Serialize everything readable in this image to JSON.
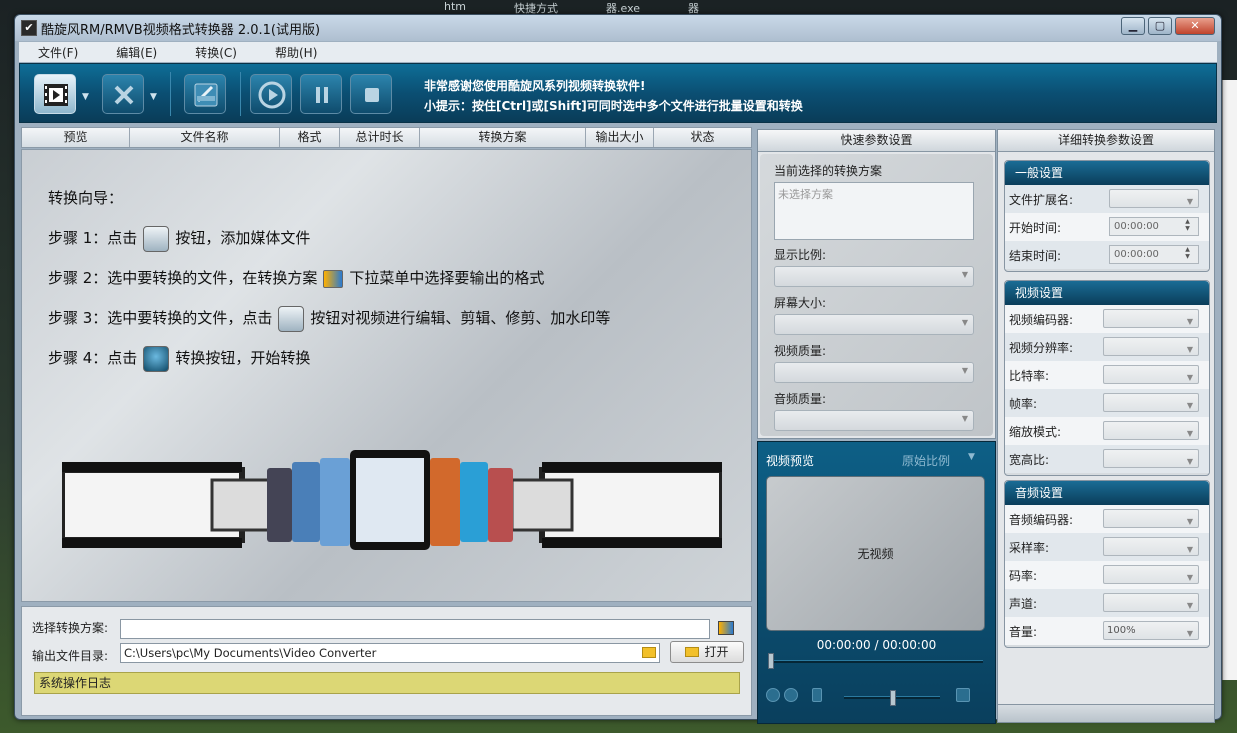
{
  "desktop": {
    "strip": [
      "htm",
      "快捷方式",
      "器.exe",
      "器"
    ]
  },
  "window": {
    "title": "酷旋风RM/RMVB视频格式转换器 2.0.1(试用版)",
    "min": "▁",
    "max": "▢",
    "close": "✕"
  },
  "menu": [
    "文件(F)",
    "编辑(E)",
    "转换(C)",
    "帮助(H)"
  ],
  "toolbar": {
    "message1": "非常感谢您使用酷旋风系列视频转换软件!",
    "message2": "小提示：按住[Ctrl]或[Shift]可同时选中多个文件进行批量设置和转换"
  },
  "list": {
    "columns": [
      "预览",
      "文件名称",
      "格式",
      "总计时长",
      "转换方案",
      "输出大小",
      "状态"
    ]
  },
  "guide": {
    "title": "转换向导：",
    "step1a": "步骤 1：点击",
    "step1b": "按钮，添加媒体文件",
    "step2a": "步骤 2：选中要转换的文件，在转换方案",
    "step2b": "下拉菜单中选择要输出的格式",
    "step3a": "步骤 3：选中要转换的文件，点击",
    "step3b": "按钮对视频进行编辑、剪辑、修剪、加水印等",
    "step4a": "步骤 4：点击",
    "step4b": "转换按钮，开始转换"
  },
  "bottom": {
    "scheme_label": "选择转换方案:",
    "scheme_value": "",
    "outdir_label": "输出文件目录:",
    "outdir_value": "C:\\Users\\pc\\My Documents\\Video Converter",
    "open_label": "打开",
    "log_label": "系统操作日志"
  },
  "quick": {
    "title": "快速参数设置",
    "current_label": "当前选择的转换方案",
    "current_placeholder": "未选择方案",
    "aspect_label": "显示比例:",
    "screen_label": "屏幕大小:",
    "vquality_label": "视频质量:",
    "aquality_label": "音频质量:"
  },
  "preview": {
    "title": "视频预览",
    "ratio": "原始比例",
    "novideo": "无视频",
    "time": "00:00:00  /  00:00:00"
  },
  "detail": {
    "title": "详细转换参数设置",
    "general": {
      "title": "一般设置",
      "ext_label": "文件扩展名:",
      "start_label": "开始时间:",
      "start_value": "00:00:00",
      "end_label": "结束时间:",
      "end_value": "00:00:00"
    },
    "video": {
      "title": "视频设置",
      "rows": [
        "视频编码器:",
        "视频分辨率:",
        "比特率:",
        "帧率:",
        "缩放模式:",
        "宽高比:"
      ]
    },
    "audio": {
      "title": "音频设置",
      "rows": [
        "音频编码器:",
        "采样率:",
        "码率:",
        "声道:",
        "音量:"
      ],
      "volume_value": "100%"
    }
  },
  "colors": {
    "toolbar": "#0b4f73",
    "log": "#dcd775",
    "accent": "#1a6c95"
  }
}
